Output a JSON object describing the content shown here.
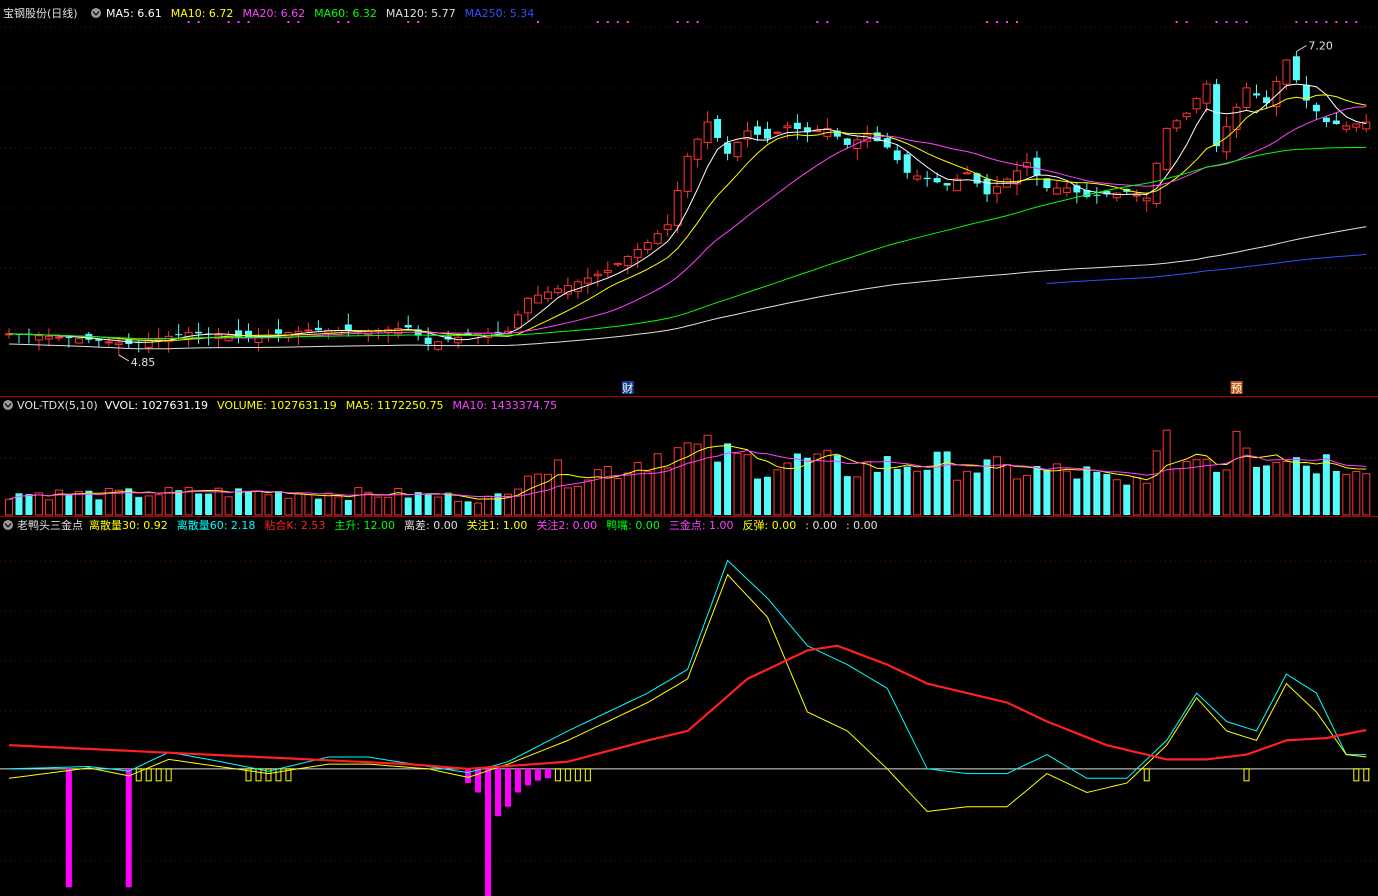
{
  "panel_price": {
    "title": "宝钢股份(日线)",
    "legend": [
      {
        "label": "MA5: 6.61",
        "color": "#ffffff"
      },
      {
        "label": "MA10: 6.72",
        "color": "#ffff00"
      },
      {
        "label": "MA20: 6.62",
        "color": "#ff40ff"
      },
      {
        "label": "MA60: 6.32",
        "color": "#00ff00"
      },
      {
        "label": "MA120: 5.77",
        "color": "#e0e0e0"
      },
      {
        "label": "MA250: 5.34",
        "color": "#3050ff"
      }
    ],
    "high_label": "7.20",
    "low_label": "4.85",
    "event_markers": [
      {
        "label": "财",
        "index": 62,
        "bg": "#1b3f8f"
      },
      {
        "label": "预",
        "index": 123,
        "bg": "#c05a10"
      }
    ]
  },
  "panel_volume": {
    "title": "VOL-TDX(5,10)",
    "legend": [
      {
        "label": "VVOL: 1027631.19",
        "color": "#ffffff"
      },
      {
        "label": "VOLUME: 1027631.19",
        "color": "#ffff00"
      },
      {
        "label": "MA5: 1172250.75",
        "color": "#ffff00"
      },
      {
        "label": "MA10: 1433374.75",
        "color": "#ff40ff"
      }
    ]
  },
  "panel_indicator": {
    "title": "老鸭头三金点",
    "legend": [
      {
        "label": "离散量30: 0.92",
        "color": "#ffff00"
      },
      {
        "label": "离散量60: 2.18",
        "color": "#00ffff"
      },
      {
        "label": "粘合K: 2.53",
        "color": "#ff2020"
      },
      {
        "label": "主升: 12.00",
        "color": "#00ff00"
      },
      {
        "label": "离差: 0.00",
        "color": "#e0e0e0"
      },
      {
        "label": "关注1: 1.00",
        "color": "#ffff00"
      },
      {
        "label": "关注2: 0.00",
        "color": "#ff40ff"
      },
      {
        "label": "鸭嘴: 0.00",
        "color": "#00ff00"
      },
      {
        "label": "三金点: 1.00",
        "color": "#ff40ff"
      },
      {
        "label": "反弹: 0.00",
        "color": "#ffff00"
      },
      {
        "label": ": 0.00",
        "color": "#e0e0e0"
      },
      {
        "label": ": 0.00",
        "color": "#e0e0e0"
      }
    ]
  },
  "colors": {
    "up": "#ff3232",
    "down": "#54fcfc",
    "grid": "#7a0000",
    "ma5": "#ffffff",
    "ma10": "#ffff00",
    "ma20": "#ff40ff",
    "ma60": "#00ff00",
    "ma120": "#e0e0e0",
    "ma250": "#3050ff",
    "magenta_bar": "#ff00ff",
    "zero_line": "#e0e0e0"
  },
  "chart_data": {
    "type": "candlestick",
    "n_bars": 137,
    "price_ylim": [
      4.6,
      7.4
    ],
    "close_anchors": [
      [
        0,
        4.98
      ],
      [
        6,
        4.95
      ],
      [
        12,
        4.9
      ],
      [
        18,
        4.99
      ],
      [
        24,
        4.95
      ],
      [
        30,
        5.01
      ],
      [
        36,
        5.0
      ],
      [
        40,
        5.03
      ],
      [
        42,
        4.9
      ],
      [
        46,
        4.97
      ],
      [
        50,
        5.0
      ],
      [
        52,
        5.26
      ],
      [
        56,
        5.36
      ],
      [
        60,
        5.48
      ],
      [
        64,
        5.7
      ],
      [
        66,
        5.84
      ],
      [
        68,
        6.38
      ],
      [
        70,
        6.65
      ],
      [
        72,
        6.4
      ],
      [
        74,
        6.58
      ],
      [
        76,
        6.52
      ],
      [
        78,
        6.62
      ],
      [
        80,
        6.57
      ],
      [
        82,
        6.6
      ],
      [
        84,
        6.47
      ],
      [
        86,
        6.55
      ],
      [
        88,
        6.45
      ],
      [
        90,
        6.25
      ],
      [
        92,
        6.2
      ],
      [
        94,
        6.15
      ],
      [
        96,
        6.25
      ],
      [
        98,
        6.08
      ],
      [
        100,
        6.2
      ],
      [
        102,
        6.33
      ],
      [
        104,
        6.13
      ],
      [
        106,
        6.13
      ],
      [
        108,
        6.06
      ],
      [
        110,
        6.08
      ],
      [
        112,
        6.1
      ],
      [
        114,
        6.05
      ],
      [
        116,
        6.6
      ],
      [
        118,
        6.72
      ],
      [
        120,
        6.95
      ],
      [
        121,
        6.46
      ],
      [
        124,
        6.92
      ],
      [
        126,
        6.8
      ],
      [
        128,
        7.14
      ],
      [
        130,
        6.82
      ],
      [
        132,
        6.65
      ],
      [
        134,
        6.62
      ],
      [
        136,
        6.65
      ]
    ],
    "volume_ylim": [
      0,
      1850000
    ],
    "volume_anchors": [
      [
        0,
        400000
      ],
      [
        10,
        380000
      ],
      [
        20,
        420000
      ],
      [
        30,
        400000
      ],
      [
        40,
        380000
      ],
      [
        48,
        300000
      ],
      [
        50,
        350000
      ],
      [
        52,
        1000000
      ],
      [
        56,
        700000
      ],
      [
        62,
        900000
      ],
      [
        66,
        1200000
      ],
      [
        70,
        1150000
      ],
      [
        76,
        900000
      ],
      [
        80,
        1000000
      ],
      [
        84,
        850000
      ],
      [
        90,
        950000
      ],
      [
        96,
        900000
      ],
      [
        100,
        800000
      ],
      [
        104,
        800000
      ],
      [
        108,
        750000
      ],
      [
        112,
        500000
      ],
      [
        114,
        800000
      ],
      [
        116,
        1200000
      ],
      [
        118,
        1000000
      ],
      [
        120,
        1100000
      ],
      [
        122,
        900000
      ],
      [
        123,
        1800000
      ],
      [
        125,
        1100000
      ],
      [
        127,
        1200000
      ],
      [
        130,
        1000000
      ],
      [
        133,
        1000000
      ],
      [
        136,
        1000000
      ]
    ],
    "indicator_ylim": [
      -2.6,
      5.0
    ],
    "disc30_anchors": [
      [
        0,
        -0.2
      ],
      [
        8,
        0.02
      ],
      [
        12,
        -0.15
      ],
      [
        16,
        0.2
      ],
      [
        20,
        0.08
      ],
      [
        26,
        -0.1
      ],
      [
        32,
        0.1
      ],
      [
        36,
        0.1
      ],
      [
        42,
        0.0
      ],
      [
        46,
        -0.18
      ],
      [
        50,
        0.1
      ],
      [
        56,
        0.6
      ],
      [
        64,
        1.4
      ],
      [
        68,
        1.9
      ],
      [
        72,
        4.1
      ],
      [
        76,
        3.2
      ],
      [
        80,
        1.2
      ],
      [
        84,
        0.8
      ],
      [
        88,
        0.0
      ],
      [
        92,
        -0.9
      ],
      [
        96,
        -0.8
      ],
      [
        100,
        -0.8
      ],
      [
        104,
        -0.1
      ],
      [
        108,
        -0.5
      ],
      [
        112,
        -0.3
      ],
      [
        116,
        0.5
      ],
      [
        119,
        1.5
      ],
      [
        122,
        0.8
      ],
      [
        125,
        0.6
      ],
      [
        128,
        1.8
      ],
      [
        131,
        1.2
      ],
      [
        134,
        0.3
      ],
      [
        136,
        0.25
      ]
    ],
    "disc60_anchors": [
      [
        0,
        0.0
      ],
      [
        8,
        0.05
      ],
      [
        12,
        -0.05
      ],
      [
        16,
        0.35
      ],
      [
        20,
        0.2
      ],
      [
        26,
        -0.05
      ],
      [
        32,
        0.25
      ],
      [
        36,
        0.25
      ],
      [
        42,
        0.05
      ],
      [
        46,
        -0.08
      ],
      [
        50,
        0.15
      ],
      [
        56,
        0.8
      ],
      [
        64,
        1.6
      ],
      [
        68,
        2.1
      ],
      [
        72,
        4.4
      ],
      [
        76,
        3.6
      ],
      [
        80,
        2.6
      ],
      [
        84,
        2.2
      ],
      [
        88,
        1.7
      ],
      [
        92,
        0.0
      ],
      [
        96,
        -0.1
      ],
      [
        100,
        -0.1
      ],
      [
        104,
        0.3
      ],
      [
        108,
        -0.2
      ],
      [
        112,
        -0.2
      ],
      [
        116,
        0.6
      ],
      [
        119,
        1.6
      ],
      [
        122,
        1.0
      ],
      [
        125,
        0.8
      ],
      [
        128,
        2.0
      ],
      [
        131,
        1.6
      ],
      [
        134,
        0.3
      ],
      [
        136,
        0.3
      ]
    ],
    "adhesion_k_anchors": [
      [
        0,
        0.5
      ],
      [
        10,
        0.4
      ],
      [
        20,
        0.3
      ],
      [
        30,
        0.2
      ],
      [
        40,
        0.1
      ],
      [
        46,
        0.0
      ],
      [
        56,
        0.15
      ],
      [
        64,
        0.6
      ],
      [
        68,
        0.8
      ],
      [
        74,
        1.9
      ],
      [
        80,
        2.5
      ],
      [
        83,
        2.6
      ],
      [
        88,
        2.2
      ],
      [
        92,
        1.8
      ],
      [
        96,
        1.6
      ],
      [
        100,
        1.4
      ],
      [
        104,
        1.0
      ],
      [
        110,
        0.5
      ],
      [
        116,
        0.2
      ],
      [
        120,
        0.2
      ],
      [
        124,
        0.3
      ],
      [
        128,
        0.6
      ],
      [
        132,
        0.65
      ],
      [
        136,
        0.82
      ]
    ],
    "magenta_bars": [
      [
        6,
        -2.5
      ],
      [
        12,
        -2.5
      ],
      [
        46,
        -0.3
      ],
      [
        47,
        -0.5
      ],
      [
        48,
        -2.7
      ],
      [
        49,
        -1.0
      ],
      [
        50,
        -0.8
      ],
      [
        51,
        -0.5
      ],
      [
        52,
        -0.35
      ],
      [
        53,
        -0.25
      ],
      [
        54,
        -0.2
      ]
    ],
    "yellow_marks": [
      13,
      14,
      15,
      16,
      24,
      25,
      26,
      27,
      28,
      55,
      56,
      57,
      58,
      114,
      124,
      135,
      136
    ]
  }
}
